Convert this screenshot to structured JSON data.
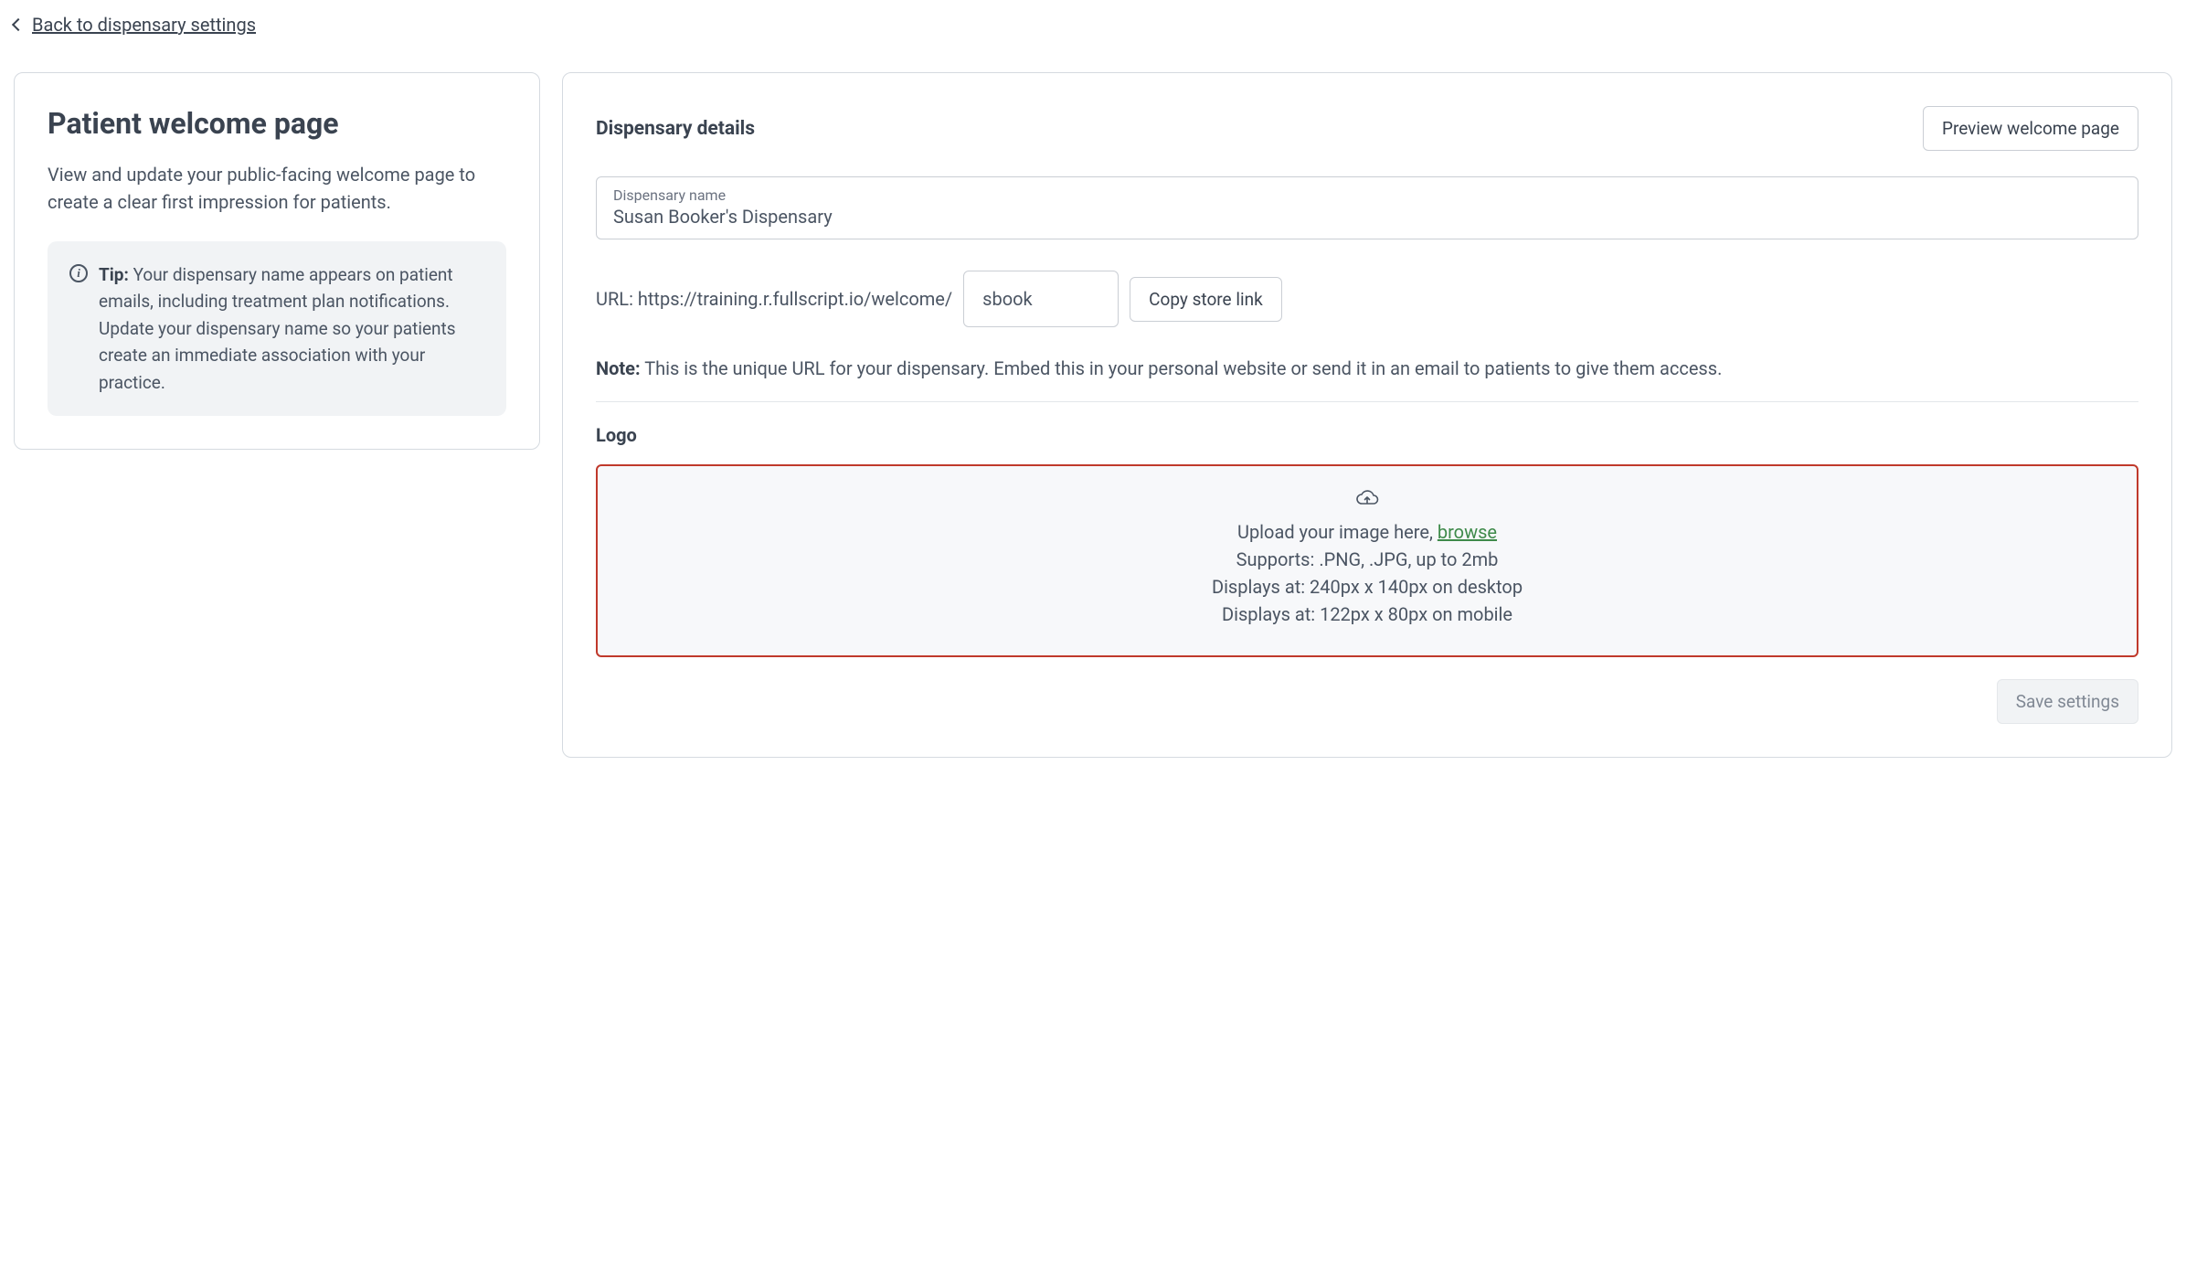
{
  "back_link": "Back to dispensary settings",
  "left": {
    "title": "Patient welcome page",
    "description": "View and update your public-facing welcome page to create a clear first impression for patients.",
    "tip_label": "Tip:",
    "tip_body": "Your dispensary name appears on patient emails, including treatment plan notifications. Update your dispensary name so your patients create an immediate association with your practice."
  },
  "right": {
    "header": "Dispensary details",
    "preview_button": "Preview welcome page",
    "dispensary_name_label": "Dispensary name",
    "dispensary_name_value": "Susan Booker's Dispensary",
    "url_prefix": "URL: https://training.r.fullscript.io/welcome/",
    "url_slug": "sbook",
    "copy_button": "Copy store link",
    "note_label": "Note:",
    "note_body": "This is the unique URL for your dispensary. Embed this in your personal website or send it in an email to patients to give them access.",
    "logo_heading": "Logo",
    "upload": {
      "line1_prefix": "Upload your image here, ",
      "browse": "browse",
      "line2": "Supports: .PNG, .JPG, up to 2mb",
      "line3": "Displays at: 240px x 140px on desktop",
      "line4": "Displays at: 122px x 80px on mobile"
    },
    "save_button": "Save settings"
  }
}
